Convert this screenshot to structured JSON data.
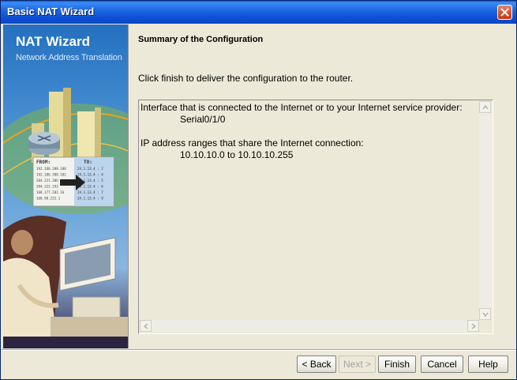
{
  "window": {
    "title": "Basic NAT Wizard"
  },
  "sidebar": {
    "title": "NAT Wizard",
    "subtitle": "Network Address Translation",
    "illustration": {
      "table_headers": [
        "FROM:",
        "TO:"
      ],
      "rows": [
        [
          "192.168.208.108",
          "24.1.13.4 : 2"
        ],
        [
          "192.106.300.102",
          "24.1.13.4 : 4"
        ],
        [
          "204.221.386",
          "24.1.13.4 : 5"
        ],
        [
          "204.322.192",
          "24.1.13.4 : 6"
        ],
        [
          "168.177.202.16",
          "24.1.13.4 : 7"
        ],
        [
          "168.90.232.1",
          "24.1.13.4 : 9"
        ]
      ]
    }
  },
  "content": {
    "heading": "Summary of the Configuration",
    "instruction": "Click finish to deliver the configuration to the router.",
    "summary": {
      "interface_label": "Interface that is connected to the Internet or to your Internet service provider:",
      "interface_value": "Serial0/1/0",
      "ip_label": "IP address ranges that share the Internet connection:",
      "ip_value": "10.10.10.0 to 10.10.10.255"
    }
  },
  "buttons": {
    "back": "< Back",
    "next": "Next >",
    "finish": "Finish",
    "cancel": "Cancel",
    "help": "Help"
  },
  "icons": [
    "close-icon",
    "scroll-up-icon",
    "scroll-down-icon",
    "scroll-left-icon",
    "scroll-right-icon",
    "arrow-icon",
    "router-icon"
  ]
}
